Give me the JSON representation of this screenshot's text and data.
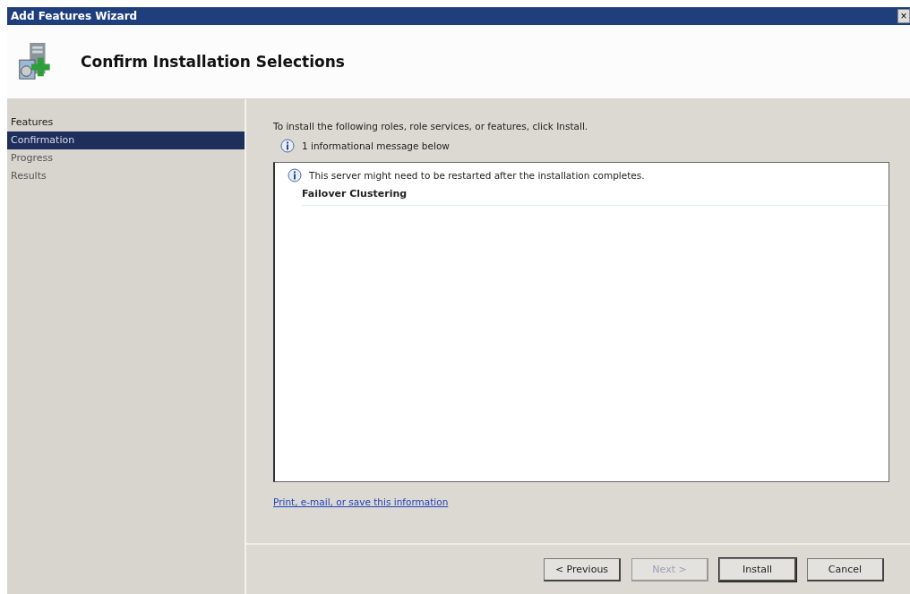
{
  "window": {
    "title": "Add Features Wizard",
    "close": "×"
  },
  "header": {
    "title": "Confirm Installation Selections"
  },
  "steps": [
    {
      "label": "Features",
      "selected": false,
      "kind": "heading"
    },
    {
      "label": "Confirmation",
      "selected": true,
      "kind": "step"
    },
    {
      "label": "Progress",
      "selected": false,
      "kind": "step"
    },
    {
      "label": "Results",
      "selected": false,
      "kind": "step"
    }
  ],
  "intro": "To install the following roles, role services, or features, click Install.",
  "info_count": "1 informational message below",
  "details": {
    "message": "This server might need to be restarted after the installation completes.",
    "features": [
      "Failover Clustering"
    ]
  },
  "link": "Print, e-mail, or save this information",
  "buttons": [
    {
      "label": "< Previous",
      "disabled": false,
      "default": false
    },
    {
      "label": "Next >",
      "disabled": true,
      "default": false
    },
    {
      "label": "Install",
      "disabled": false,
      "default": true
    },
    {
      "label": "Cancel",
      "disabled": false,
      "default": false
    }
  ]
}
